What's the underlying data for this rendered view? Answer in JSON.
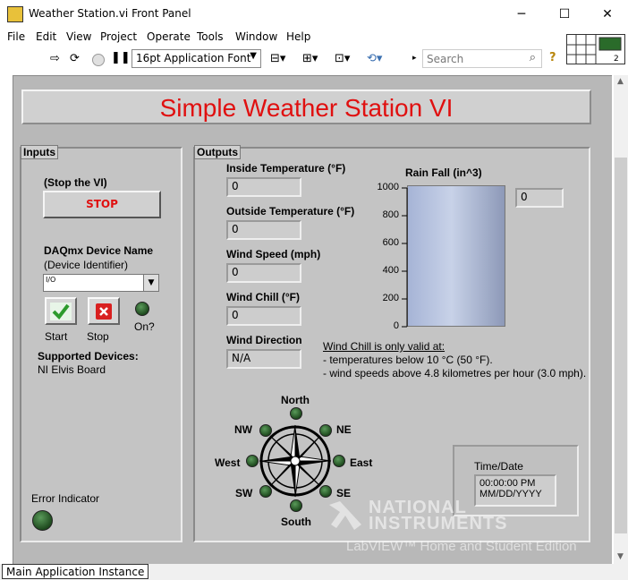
{
  "window": {
    "title": "Weather Station.vi Front Panel",
    "min": "─",
    "max": "☐",
    "close": "✕"
  },
  "menu": [
    "File",
    "Edit",
    "View",
    "Project",
    "Operate",
    "Tools",
    "Window",
    "Help"
  ],
  "toolbar": {
    "font": "16pt Application Font",
    "search_placeholder": "Search",
    "help": "?"
  },
  "panel_title": "Simple Weather Station VI",
  "inputs": {
    "section": "Inputs",
    "stop_caption": "(Stop the VI)",
    "stop_label": "STOP",
    "daq_label": "DAQmx Device Name",
    "daq_sub": "(Device Identifier)",
    "daq_prefix": "I/O",
    "start_label": "Start",
    "stop_btn_label": "Stop",
    "on_label": "On?",
    "supported_label": "Supported Devices:",
    "supported_value": "NI Elvis Board",
    "error_label": "Error Indicator"
  },
  "outputs": {
    "section": "Outputs",
    "indicators": [
      {
        "label": "Inside Temperature (°F)",
        "value": "0"
      },
      {
        "label": "Outside Temperature (°F)",
        "value": "0"
      },
      {
        "label": "Wind Speed (mph)",
        "value": "0"
      },
      {
        "label": "Wind Chill (°F)",
        "value": "0"
      },
      {
        "label": "Wind Direction",
        "value": "N/A"
      }
    ],
    "rain": {
      "label": "Rain Fall (in^3)",
      "value": "0",
      "ticks": [
        "1000",
        "800",
        "600",
        "400",
        "200",
        "0"
      ]
    },
    "note": {
      "title": "Wind Chill is only valid at:",
      "line1": "- temperatures below 10 °C (50 °F).",
      "line2": "- wind speeds above 4.8 kilometres per hour (3.0 mph)."
    },
    "compass": {
      "N": "North",
      "NE": "NE",
      "E": "East",
      "SE": "SE",
      "S": "South",
      "SW": "SW",
      "W": "West",
      "NW": "NW"
    },
    "time": {
      "label": "Time/Date",
      "line1": "00:00:00 PM",
      "line2": "MM/DD/YYYY"
    }
  },
  "watermark": {
    "line1": "NATIONAL",
    "line2": "INSTRUMENTS",
    "line3": "LabVIEW™ Home and Student Edition"
  },
  "status": "Main Application Instance"
}
